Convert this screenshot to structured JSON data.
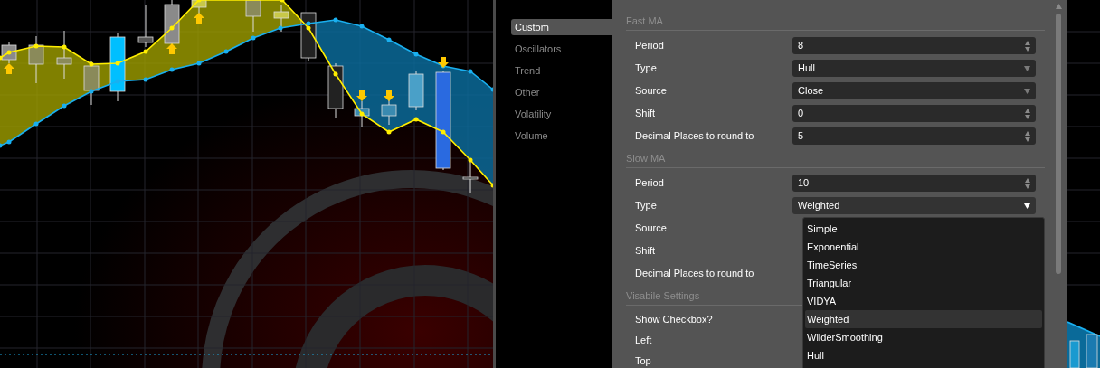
{
  "sidebar": {
    "items": [
      {
        "label": "Custom",
        "selected": true
      },
      {
        "label": "Oscillators",
        "selected": false
      },
      {
        "label": "Trend",
        "selected": false
      },
      {
        "label": "Other",
        "selected": false
      },
      {
        "label": "Volatility",
        "selected": false
      },
      {
        "label": "Volume",
        "selected": false
      }
    ]
  },
  "sections": [
    {
      "title": "Fast MA",
      "rows": [
        {
          "label": "Period",
          "field": {
            "kind": "spin",
            "value": "8"
          }
        },
        {
          "label": "Type",
          "field": {
            "kind": "select",
            "value": "Hull",
            "open": false
          }
        },
        {
          "label": "Source",
          "field": {
            "kind": "select",
            "value": "Close",
            "open": false
          }
        },
        {
          "label": "Shift",
          "field": {
            "kind": "spin",
            "value": "0"
          }
        },
        {
          "label": "Decimal Places to round to",
          "field": {
            "kind": "spin",
            "value": "5"
          }
        }
      ]
    },
    {
      "title": "Slow MA",
      "rows": [
        {
          "label": "Period",
          "field": {
            "kind": "spin",
            "value": "10"
          }
        },
        {
          "label": "Type",
          "field": {
            "kind": "select",
            "value": "Weighted",
            "open": true
          }
        },
        {
          "label": "Source"
        },
        {
          "label": "Shift"
        },
        {
          "label": "Decimal Places to round to"
        }
      ]
    },
    {
      "title": "Visabile Settings",
      "rows": [
        {
          "label": "Show Checkbox?"
        },
        {
          "label": "Left"
        },
        {
          "label": "Top"
        }
      ]
    }
  ],
  "dropdown": {
    "options": [
      {
        "label": "Simple",
        "selected": false
      },
      {
        "label": "Exponential",
        "selected": false
      },
      {
        "label": "TimeSeries",
        "selected": false
      },
      {
        "label": "Triangular",
        "selected": false
      },
      {
        "label": "VIDYA",
        "selected": false
      },
      {
        "label": "Weighted",
        "selected": true
      },
      {
        "label": "WilderSmoothing",
        "selected": false
      },
      {
        "label": "Hull",
        "selected": false
      }
    ]
  }
}
